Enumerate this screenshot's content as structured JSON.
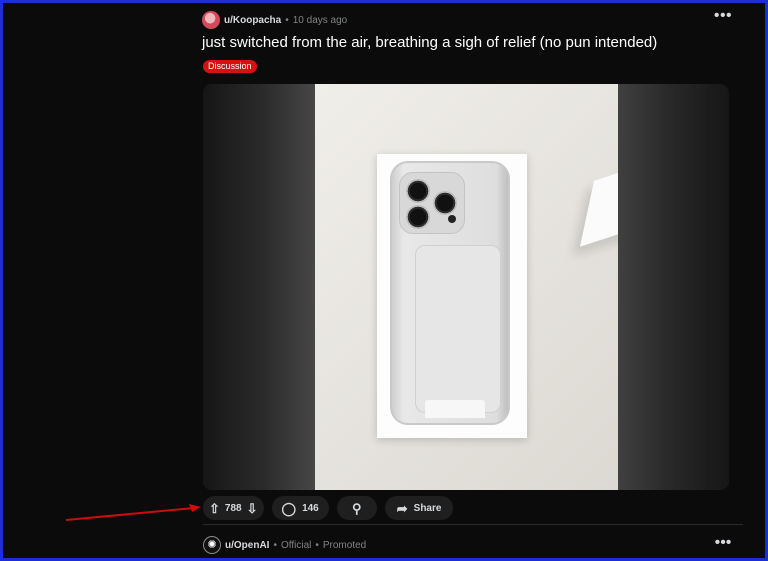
{
  "post": {
    "username": "u/Koopacha",
    "separator": "•",
    "time": "10 days ago",
    "more": "•••",
    "title": "just switched from the air, breathing a sigh of relief (no pun intended)",
    "flair": "Discussion"
  },
  "actions": {
    "upvote_icon": "⇧",
    "vote_count": "788",
    "downvote_icon": "⇩",
    "comment_icon": "◯",
    "comment_count": "146",
    "award_icon": "⚲",
    "share_icon": "➦",
    "share_label": "Share"
  },
  "promoted": {
    "username": "u/OpenAI",
    "separator": "•",
    "official": "Official",
    "separator2": "•",
    "promoted": "Promoted",
    "more": "•••"
  },
  "colors": {
    "frame": "#1a2fd6",
    "background": "#0b0b0b",
    "flair": "#d41212",
    "arrow": "#d10b0b",
    "pill": "#1f1f1f"
  }
}
